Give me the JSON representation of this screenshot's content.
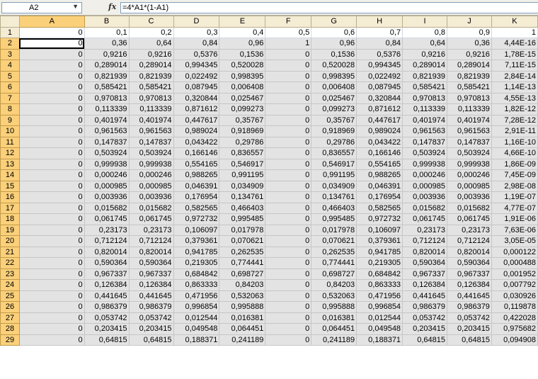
{
  "formula_bar": {
    "name_box": "A2",
    "fx_label": "fx",
    "formula": "=4*A1*(1-A1)"
  },
  "sheet": {
    "columns": [
      "A",
      "B",
      "C",
      "D",
      "E",
      "F",
      "G",
      "H",
      "I",
      "J",
      "K"
    ],
    "rows": [
      {
        "num": "1",
        "cells": [
          "0",
          "0,1",
          "0,2",
          "0,3",
          "0,4",
          "0,5",
          "0,6",
          "0,7",
          "0,8",
          "0,9",
          "1"
        ]
      },
      {
        "num": "2",
        "cells": [
          "0",
          "0,36",
          "0,64",
          "0,84",
          "0,96",
          "1",
          "0,96",
          "0,84",
          "0,64",
          "0,36",
          "4,44E-16"
        ]
      },
      {
        "num": "3",
        "cells": [
          "0",
          "0,9216",
          "0,9216",
          "0,5376",
          "0,1536",
          "0",
          "0,1536",
          "0,5376",
          "0,9216",
          "0,9216",
          "1,78E-15"
        ]
      },
      {
        "num": "4",
        "cells": [
          "0",
          "0,289014",
          "0,289014",
          "0,994345",
          "0,520028",
          "0",
          "0,520028",
          "0,994345",
          "0,289014",
          "0,289014",
          "7,11E-15"
        ]
      },
      {
        "num": "5",
        "cells": [
          "0",
          "0,821939",
          "0,821939",
          "0,022492",
          "0,998395",
          "0",
          "0,998395",
          "0,022492",
          "0,821939",
          "0,821939",
          "2,84E-14"
        ]
      },
      {
        "num": "6",
        "cells": [
          "0",
          "0,585421",
          "0,585421",
          "0,087945",
          "0,006408",
          "0",
          "0,006408",
          "0,087945",
          "0,585421",
          "0,585421",
          "1,14E-13"
        ]
      },
      {
        "num": "7",
        "cells": [
          "0",
          "0,970813",
          "0,970813",
          "0,320844",
          "0,025467",
          "0",
          "0,025467",
          "0,320844",
          "0,970813",
          "0,970813",
          "4,55E-13"
        ]
      },
      {
        "num": "8",
        "cells": [
          "0",
          "0,113339",
          "0,113339",
          "0,871612",
          "0,099273",
          "0",
          "0,099273",
          "0,871612",
          "0,113339",
          "0,113339",
          "1,82E-12"
        ]
      },
      {
        "num": "9",
        "cells": [
          "0",
          "0,401974",
          "0,401974",
          "0,447617",
          "0,35767",
          "0",
          "0,35767",
          "0,447617",
          "0,401974",
          "0,401974",
          "7,28E-12"
        ]
      },
      {
        "num": "10",
        "cells": [
          "0",
          "0,961563",
          "0,961563",
          "0,989024",
          "0,918969",
          "0",
          "0,918969",
          "0,989024",
          "0,961563",
          "0,961563",
          "2,91E-11"
        ]
      },
      {
        "num": "11",
        "cells": [
          "0",
          "0,147837",
          "0,147837",
          "0,043422",
          "0,29786",
          "0",
          "0,29786",
          "0,043422",
          "0,147837",
          "0,147837",
          "1,16E-10"
        ]
      },
      {
        "num": "12",
        "cells": [
          "0",
          "0,503924",
          "0,503924",
          "0,166146",
          "0,836557",
          "0",
          "0,836557",
          "0,166146",
          "0,503924",
          "0,503924",
          "4,66E-10"
        ]
      },
      {
        "num": "13",
        "cells": [
          "0",
          "0,999938",
          "0,999938",
          "0,554165",
          "0,546917",
          "0",
          "0,546917",
          "0,554165",
          "0,999938",
          "0,999938",
          "1,86E-09"
        ]
      },
      {
        "num": "14",
        "cells": [
          "0",
          "0,000246",
          "0,000246",
          "0,988265",
          "0,991195",
          "0",
          "0,991195",
          "0,988265",
          "0,000246",
          "0,000246",
          "7,45E-09"
        ]
      },
      {
        "num": "15",
        "cells": [
          "0",
          "0,000985",
          "0,000985",
          "0,046391",
          "0,034909",
          "0",
          "0,034909",
          "0,046391",
          "0,000985",
          "0,000985",
          "2,98E-08"
        ]
      },
      {
        "num": "16",
        "cells": [
          "0",
          "0,003936",
          "0,003936",
          "0,176954",
          "0,134761",
          "0",
          "0,134761",
          "0,176954",
          "0,003936",
          "0,003936",
          "1,19E-07"
        ]
      },
      {
        "num": "17",
        "cells": [
          "0",
          "0,015682",
          "0,015682",
          "0,582565",
          "0,466403",
          "0",
          "0,466403",
          "0,582565",
          "0,015682",
          "0,015682",
          "4,77E-07"
        ]
      },
      {
        "num": "18",
        "cells": [
          "0",
          "0,061745",
          "0,061745",
          "0,972732",
          "0,995485",
          "0",
          "0,995485",
          "0,972732",
          "0,061745",
          "0,061745",
          "1,91E-06"
        ]
      },
      {
        "num": "19",
        "cells": [
          "0",
          "0,23173",
          "0,23173",
          "0,106097",
          "0,017978",
          "0",
          "0,017978",
          "0,106097",
          "0,23173",
          "0,23173",
          "7,63E-06"
        ]
      },
      {
        "num": "20",
        "cells": [
          "0",
          "0,712124",
          "0,712124",
          "0,379361",
          "0,070621",
          "0",
          "0,070621",
          "0,379361",
          "0,712124",
          "0,712124",
          "3,05E-05"
        ]
      },
      {
        "num": "21",
        "cells": [
          "0",
          "0,820014",
          "0,820014",
          "0,941785",
          "0,262535",
          "0",
          "0,262535",
          "0,941785",
          "0,820014",
          "0,820014",
          "0,000122"
        ]
      },
      {
        "num": "22",
        "cells": [
          "0",
          "0,590364",
          "0,590364",
          "0,219305",
          "0,774441",
          "0",
          "0,774441",
          "0,219305",
          "0,590364",
          "0,590364",
          "0,000488"
        ]
      },
      {
        "num": "23",
        "cells": [
          "0",
          "0,967337",
          "0,967337",
          "0,684842",
          "0,698727",
          "0",
          "0,698727",
          "0,684842",
          "0,967337",
          "0,967337",
          "0,001952"
        ]
      },
      {
        "num": "24",
        "cells": [
          "0",
          "0,126384",
          "0,126384",
          "0,863333",
          "0,84203",
          "0",
          "0,84203",
          "0,863333",
          "0,126384",
          "0,126384",
          "0,007792"
        ]
      },
      {
        "num": "25",
        "cells": [
          "0",
          "0,441645",
          "0,441645",
          "0,471956",
          "0,532063",
          "0",
          "0,532063",
          "0,471956",
          "0,441645",
          "0,441645",
          "0,030926"
        ]
      },
      {
        "num": "26",
        "cells": [
          "0",
          "0,986379",
          "0,986379",
          "0,996854",
          "0,995888",
          "0",
          "0,995888",
          "0,996854",
          "0,986379",
          "0,986379",
          "0,119878"
        ]
      },
      {
        "num": "27",
        "cells": [
          "0",
          "0,053742",
          "0,053742",
          "0,012544",
          "0,016381",
          "0",
          "0,016381",
          "0,012544",
          "0,053742",
          "0,053742",
          "0,422028"
        ]
      },
      {
        "num": "28",
        "cells": [
          "0",
          "0,203415",
          "0,203415",
          "0,049548",
          "0,064451",
          "0",
          "0,064451",
          "0,049548",
          "0,203415",
          "0,203415",
          "0,975682"
        ]
      },
      {
        "num": "29",
        "cells": [
          "0",
          "0,64815",
          "0,64815",
          "0,188371",
          "0,241189",
          "0",
          "0,241189",
          "0,188371",
          "0,64815",
          "0,64815",
          "0,094908"
        ]
      }
    ]
  }
}
